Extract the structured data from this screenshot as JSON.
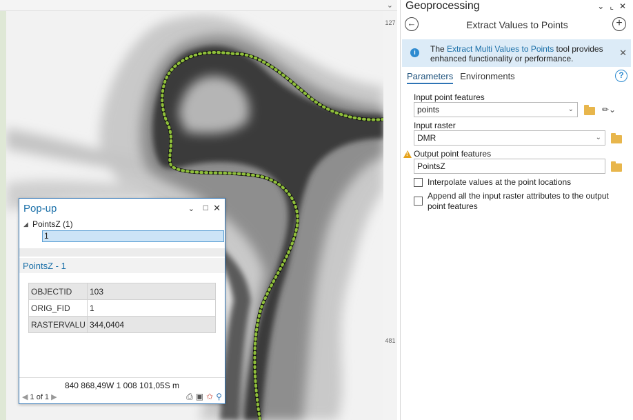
{
  "map": {
    "edge_labels": [
      "127",
      "481"
    ]
  },
  "popup": {
    "title": "Pop-up",
    "layer_label": "PointsZ (1)",
    "feature_id": "1",
    "subtitle": "PointsZ - 1",
    "fields": [
      {
        "name": "OBJECTID",
        "value": "103"
      },
      {
        "name": "ORIG_FID",
        "value": "1"
      },
      {
        "name": "RASTERVALU",
        "value": "344,0404"
      }
    ],
    "coordinates": "840 868,49W 1 008 101,05S m",
    "pager": "1 of 1"
  },
  "geoprocessing": {
    "pane_title": "Geoprocessing",
    "tool_name": "Extract Values to Points",
    "info": {
      "prefix": "The ",
      "link": "Extract Multi Values to Points",
      "suffix": " tool provides enhanced functionality or performance."
    },
    "tabs": [
      "Parameters",
      "Environments"
    ],
    "params": {
      "input_point_label": "Input point features",
      "input_point_value": "points",
      "input_raster_label": "Input raster",
      "input_raster_value": "DMR",
      "output_label": "Output point features",
      "output_value": "PointsZ",
      "interpolate_label": "Interpolate values at the point locations",
      "append_label": "Append all the input raster attributes to the output point features"
    }
  },
  "colors": {
    "accent": "#2e74b5",
    "river_points": "#8fbf3a",
    "info_bg": "#dcebf7",
    "warning": "#e6a21a"
  }
}
